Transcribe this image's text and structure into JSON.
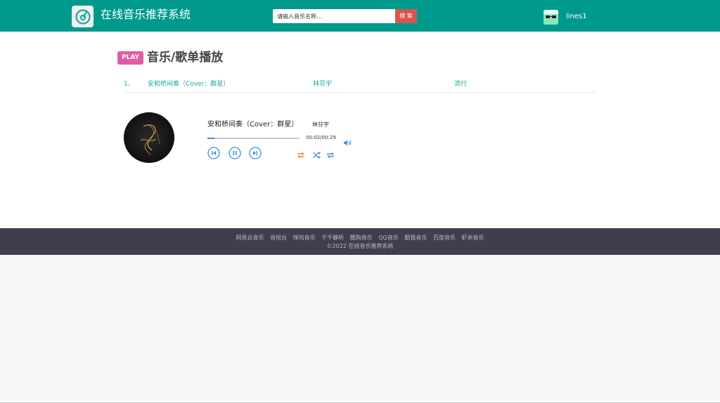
{
  "header": {
    "site_title": "在线音乐推荐系统",
    "search_placeholder": "请输入音乐名称...",
    "search_button": "搜 索",
    "username": "lines1",
    "logo_icon": "music-disc-icon",
    "avatar_icon": "sunglasses-avatar-icon"
  },
  "main": {
    "badge": "PLAY",
    "title": "音乐/歌单播放",
    "playlist": [
      {
        "index": "1、",
        "title": "安和桥间奏（Cover：群星）",
        "artist": "林芬宇",
        "genre": "流行"
      }
    ]
  },
  "player": {
    "song_title": "安和桥间奏（Cover：群星）",
    "artist": "林芬宇",
    "current_time": "00:02",
    "duration": "00:29",
    "time_text": "00:02/00:29",
    "progress": 0.08,
    "controls": [
      "previous-icon",
      "pause-icon",
      "next-icon",
      "repeat-icon",
      "shuffle-icon",
      "loop-icon",
      "volume-icon"
    ]
  },
  "footer": {
    "links": [
      "网易云音乐",
      "音悦台",
      "咪咕音乐",
      "千千静听",
      "酷狗音乐",
      "QQ音乐",
      "酷我音乐",
      "百度音乐",
      "虾米音乐"
    ],
    "copyright": "©2022 在线音乐推荐系统"
  },
  "colors": {
    "header_bg": "#009a8c",
    "accent": "#1aa99a",
    "badge": "#e25ba6",
    "search_button": "#d9534f",
    "footer_bg": "#403e4e",
    "control_blue": "#3b8fe0",
    "repeat_orange": "#f07a21"
  }
}
